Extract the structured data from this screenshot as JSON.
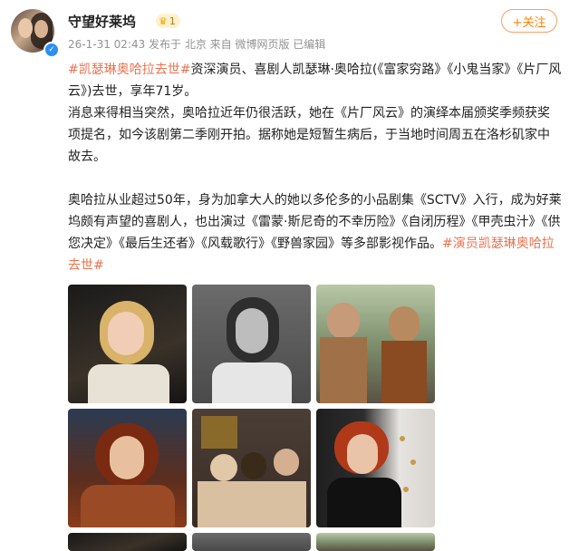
{
  "user": {
    "name": "守望好莱坞",
    "level": "1",
    "meta": "26-1-31 02:43 发布于 北京 来自 微博网页版 已编辑"
  },
  "follow_label": "+关注",
  "post": {
    "tag_main": "#凯瑟琳奥哈拉去世#",
    "line1_rest": "资深演员、喜剧人凯瑟琳·奥哈拉(《富家穷路》《小鬼当家》《片厂风云》)去世，享年71岁。",
    "para2": "消息来得相当突然，奥哈拉近年仍很活跃，她在《片厂风云》的演绎本届颁奖季频获奖项提名，如今该剧第二季刚开拍。据称她是短暂生病后，于当地时间周五在洛杉矶家中故去。",
    "para3": "奥哈拉从业超过50年，身为加拿大人的她以多伦多的小品剧集《SCTV》入行，成为好莱坞颇有声望的喜剧人，也出演过《雷蒙·斯尼奇的不幸历险》《自闭历程》《甲壳虫汁》《供您决定》《最后生还者》《风载歌行》《野兽家园》等多部影视作品。",
    "tag_end": "#演员凯瑟琳奥哈拉去世#"
  },
  "colors": {
    "tag": "#eb7350",
    "follow": "#ff8200",
    "meta": "#939393"
  },
  "icons": {
    "verify": "verified-badge-icon",
    "level": "crown-icon"
  }
}
